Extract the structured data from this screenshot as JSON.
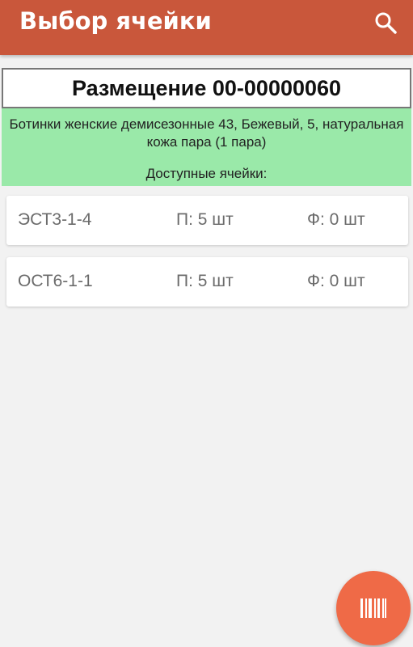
{
  "app_bar": {
    "title": "Выбор ячейки",
    "search_icon": "search-icon"
  },
  "document": {
    "title": "Размещение 00-00000060",
    "product": "Ботинки женские демисезонные 43, Бежевый, 5, натуральная кожа пара (1 пара)",
    "available_label": "Доступные ячейки:"
  },
  "cells": [
    {
      "name": "ЭСТ3-1-4",
      "plan": "П: 5 шт",
      "fact": "Ф: 0 шт"
    },
    {
      "name": "ОСТ6-1-1",
      "plan": "П: 5 шт",
      "fact": "Ф: 0 шт"
    }
  ],
  "fab": {
    "icon": "barcode-icon"
  },
  "colors": {
    "app_bar": "#c9573b",
    "info_background": "#9ae9a9",
    "fab": "#ef6a47",
    "background": "#f2f2f2"
  }
}
